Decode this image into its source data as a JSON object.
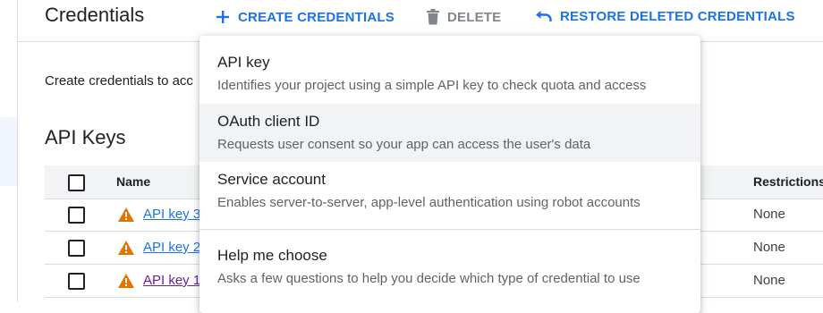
{
  "header": {
    "title": "Credentials",
    "create_label": "CREATE CREDENTIALS",
    "delete_label": "DELETE",
    "restore_label": "RESTORE DELETED CREDENTIALS"
  },
  "intro_text": "Create credentials to acc",
  "api_keys": {
    "title": "API Keys",
    "columns": {
      "name": "Name",
      "restrictions": "Restrictions"
    },
    "rows": [
      {
        "name": "API key 3",
        "restrictions": "None"
      },
      {
        "name": "API key 2",
        "restrictions": "None"
      },
      {
        "name": "API key 1",
        "restrictions": "None"
      }
    ]
  },
  "menu": {
    "items": [
      {
        "title": "API key",
        "description": "Identifies your project using a simple API key to check quota and access"
      },
      {
        "title": "OAuth client ID",
        "description": "Requests user consent so your app can access the user's data"
      },
      {
        "title": "Service account",
        "description": "Enables server-to-server, app-level authentication using robot accounts"
      },
      {
        "title": "Help me choose",
        "description": "Asks a few questions to help you decide which type of credential to use"
      }
    ]
  },
  "colors": {
    "accent": "#1a73e8",
    "warning": "#e37400",
    "visited_link": "#681da8",
    "menu_hover": "#f1f3f4"
  },
  "icons": [
    "plus-icon",
    "trash-icon",
    "undo-icon",
    "warning-icon"
  ]
}
